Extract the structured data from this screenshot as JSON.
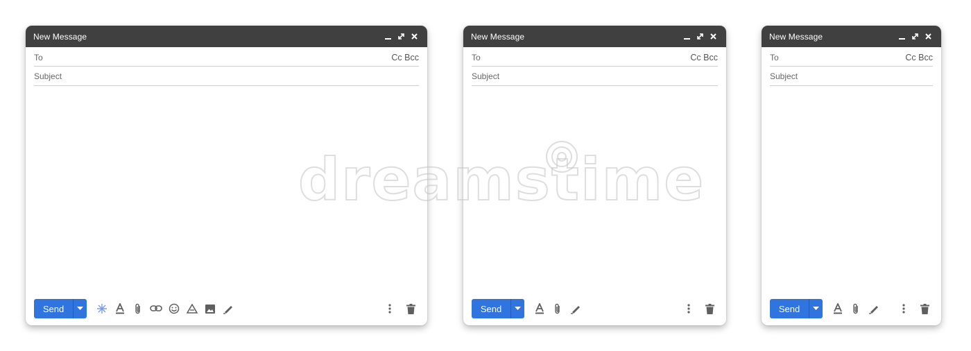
{
  "windows": [
    {
      "title": "New Message",
      "to_label": "To",
      "cc_bcc": "Cc Bcc",
      "subject_placeholder": "Subject",
      "send_label": "Send",
      "toolbar_icons": [
        "ai-sparkle-icon",
        "text-format-icon",
        "attach-icon",
        "link-icon",
        "emoji-icon",
        "drive-icon",
        "photo-icon",
        "signature-icon"
      ]
    },
    {
      "title": "New Message",
      "to_label": "To",
      "cc_bcc": "Cc Bcc",
      "subject_placeholder": "Subject",
      "send_label": "Send",
      "toolbar_icons": [
        "text-format-icon",
        "attach-icon",
        "signature-icon"
      ]
    },
    {
      "title": "New Message",
      "to_label": "To",
      "cc_bcc": "Cc Bcc",
      "subject_placeholder": "Subject",
      "send_label": "Send",
      "toolbar_icons": [
        "text-format-icon",
        "attach-icon",
        "signature-icon"
      ]
    }
  ],
  "watermark": "dreamstime",
  "colors": {
    "titlebar": "#404040",
    "send": "#2f74df",
    "icon": "#5f5f5f"
  }
}
